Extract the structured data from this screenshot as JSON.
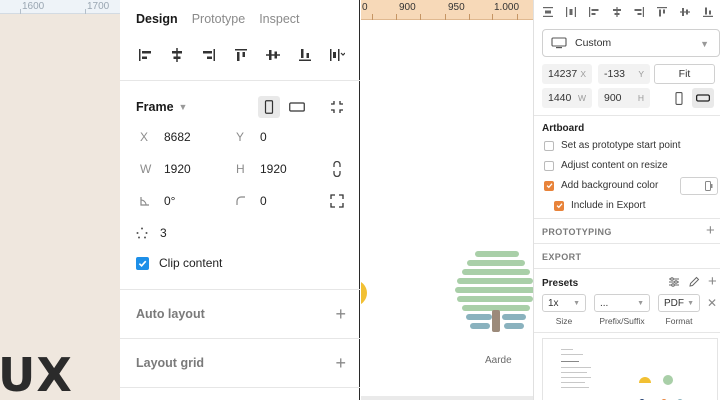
{
  "left_canvas": {
    "ruler": [
      "1600",
      "1700"
    ],
    "text": "UX"
  },
  "design_panel": {
    "tabs": [
      {
        "label": "Design",
        "active": true
      },
      {
        "label": "Prototype",
        "active": false
      },
      {
        "label": "Inspect",
        "active": false
      }
    ],
    "frame": {
      "title": "Frame",
      "x_label": "X",
      "x_value": "8682",
      "y_label": "Y",
      "y_value": "0",
      "w_label": "W",
      "w_value": "1920",
      "h_label": "H",
      "h_value": "1920",
      "rotation_value": "0°",
      "radius_value": "0",
      "dots_value": "3",
      "clip_label": "Clip content",
      "clip_checked": true
    },
    "sections": {
      "auto_layout": "Auto layout",
      "layout_grid": "Layout grid"
    }
  },
  "center_canvas": {
    "ruler": [
      "0",
      "900",
      "950",
      "1.000"
    ],
    "tree_label": "Aarde"
  },
  "inspector": {
    "preset_label": "Custom",
    "x_value": "14237",
    "x_unit": "X",
    "y_value": "-133",
    "y_unit": "Y",
    "fit_label": "Fit",
    "w_value": "1440",
    "w_unit": "W",
    "h_value": "900",
    "h_unit": "H",
    "artboard_heading": "Artboard",
    "set_start": "Set as prototype start point",
    "adjust_content": "Adjust content on resize",
    "add_bg": "Add background color",
    "include_export": "Include in Export",
    "prototyping_heading": "PROTOTYPING",
    "export_heading": "EXPORT",
    "presets_heading": "Presets",
    "size_value": "1x",
    "prefix_value": "...",
    "format_value": "PDF",
    "size_caption": "Size",
    "prefix_caption": "Prefix/Suffix",
    "format_caption": "Format"
  },
  "colors": {
    "accent_blue": "#1d8fe8",
    "accent_orange": "#e8833a",
    "ruler_orange": "#f7d9b8",
    "canvas_beige": "#efe7de",
    "tree_green": "#a9cfa8"
  }
}
